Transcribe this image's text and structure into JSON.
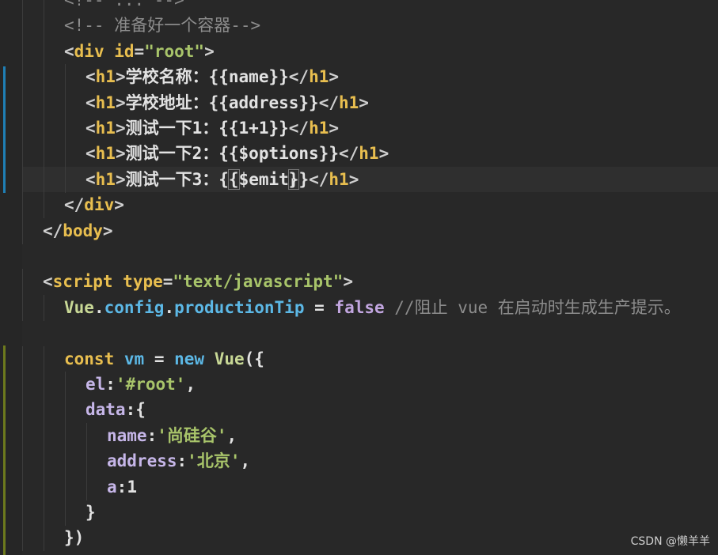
{
  "editor": {
    "lines": [
      [
        [
          "<!-- ... -->",
          "c"
        ]
      ],
      [
        [
          "<!-- 准备好一个容器-->",
          "c"
        ]
      ],
      [
        [
          "<",
          "p"
        ],
        [
          "div",
          "t"
        ],
        [
          " ",
          "x"
        ],
        [
          "id",
          "a"
        ],
        [
          "=",
          "p"
        ],
        [
          "\"root\"",
          "s"
        ],
        [
          ">",
          "p"
        ]
      ],
      [
        [
          "<",
          "p"
        ],
        [
          "h1",
          "t"
        ],
        [
          ">",
          "p"
        ],
        [
          "学校名称：{{name}}",
          "x"
        ],
        [
          "</",
          "p"
        ],
        [
          "h1",
          "t"
        ],
        [
          ">",
          "p"
        ]
      ],
      [
        [
          "<",
          "p"
        ],
        [
          "h1",
          "t"
        ],
        [
          ">",
          "p"
        ],
        [
          "学校地址：{{address}}",
          "x"
        ],
        [
          "</",
          "p"
        ],
        [
          "h1",
          "t"
        ],
        [
          ">",
          "p"
        ]
      ],
      [
        [
          "<",
          "p"
        ],
        [
          "h1",
          "t"
        ],
        [
          ">",
          "p"
        ],
        [
          "测试一下1：{{1+1}}",
          "x"
        ],
        [
          "</",
          "p"
        ],
        [
          "h1",
          "t"
        ],
        [
          ">",
          "p"
        ]
      ],
      [
        [
          "<",
          "p"
        ],
        [
          "h1",
          "t"
        ],
        [
          ">",
          "p"
        ],
        [
          "测试一下2：{{$options}}",
          "x"
        ],
        [
          "</",
          "p"
        ],
        [
          "h1",
          "t"
        ],
        [
          ">",
          "p"
        ]
      ],
      [
        [
          "<",
          "p"
        ],
        [
          "h1",
          "t"
        ],
        [
          ">",
          "p"
        ],
        [
          "测试一下3：{",
          "x"
        ],
        [
          "{",
          "x bracket"
        ],
        [
          "$emit",
          "x"
        ],
        [
          "}",
          "x bracket"
        ],
        [
          "}",
          "x"
        ],
        [
          "</",
          "p"
        ],
        [
          "h1",
          "t"
        ],
        [
          ">",
          "p"
        ]
      ],
      [
        [
          "</",
          "p"
        ],
        [
          "div",
          "t"
        ],
        [
          ">",
          "p"
        ]
      ],
      [
        [
          "</",
          "p"
        ],
        [
          "body",
          "t"
        ],
        [
          ">",
          "p"
        ]
      ],
      [],
      [
        [
          "<",
          "p"
        ],
        [
          "script",
          "t"
        ],
        [
          " ",
          "x"
        ],
        [
          "type",
          "a"
        ],
        [
          "=",
          "p"
        ],
        [
          "\"text/javascript\"",
          "s"
        ],
        [
          ">",
          "p"
        ]
      ],
      [
        [
          "Vue",
          "v"
        ],
        [
          ".",
          "x"
        ],
        [
          "config",
          "b"
        ],
        [
          ".",
          "x"
        ],
        [
          "productionTip",
          "b"
        ],
        [
          " = ",
          "x"
        ],
        [
          "false",
          "f"
        ],
        [
          " //阻止 vue 在启动时生成生产提示。",
          "c"
        ]
      ],
      [],
      [
        [
          "const",
          "k"
        ],
        [
          " ",
          "x"
        ],
        [
          "vm",
          "b"
        ],
        [
          " = ",
          "x"
        ],
        [
          "new",
          "b"
        ],
        [
          " ",
          "x"
        ],
        [
          "Vue",
          "v"
        ],
        [
          "({",
          "x"
        ]
      ],
      [
        [
          "el",
          "pr"
        ],
        [
          ":",
          "x"
        ],
        [
          "'#root'",
          "s"
        ],
        [
          ",",
          "x"
        ]
      ],
      [
        [
          "data",
          "pr"
        ],
        [
          ":{",
          "x"
        ]
      ],
      [
        [
          "name",
          "pr"
        ],
        [
          ":",
          "x"
        ],
        [
          "'尚硅谷'",
          "s"
        ],
        [
          ",",
          "x"
        ]
      ],
      [
        [
          "address",
          "pr"
        ],
        [
          ":",
          "x"
        ],
        [
          "'北京'",
          "s"
        ],
        [
          ",",
          "x"
        ]
      ],
      [
        [
          "a",
          "pr"
        ],
        [
          ":",
          "x"
        ],
        [
          "1",
          "n"
        ]
      ],
      [
        [
          "}",
          "x"
        ]
      ],
      [
        [
          "})",
          "x"
        ]
      ]
    ],
    "indents": [
      3,
      3,
      3,
      4,
      4,
      4,
      4,
      4,
      3,
      2,
      0,
      2,
      3,
      0,
      3,
      4,
      4,
      5,
      5,
      5,
      4,
      3
    ],
    "current_line": 7,
    "watermark": "CSDN @懒羊羊"
  }
}
